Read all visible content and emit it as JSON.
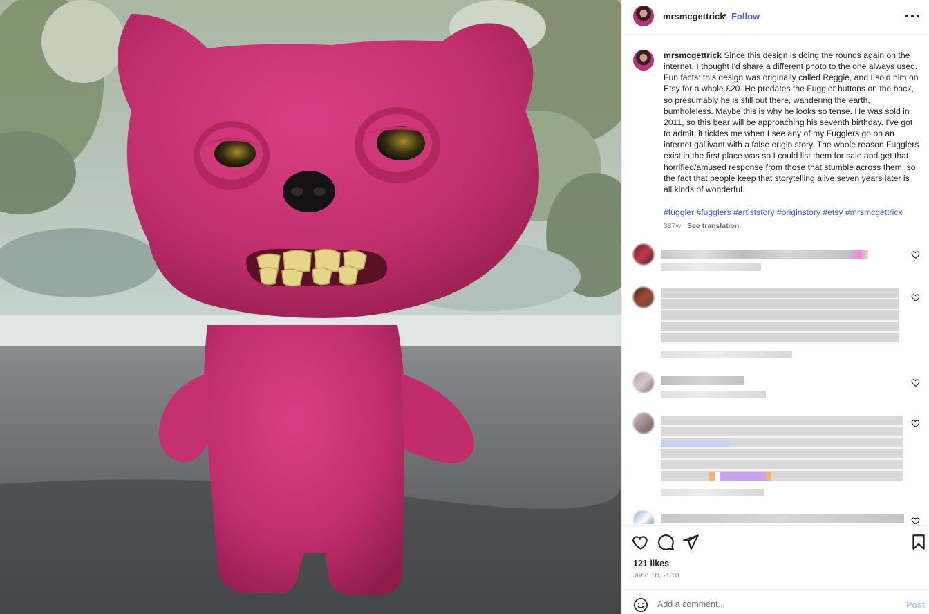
{
  "post": {
    "username": "mrsmcgettrick",
    "separator": "•",
    "follow_label": "Follow",
    "more_icon": "more-horizontal-icon",
    "photo_description_icon": "photo",
    "caption": "Since this design is doing the rounds again on the internet, I thought I'd share a different photo to the one always used. Fun facts: this design was originally called Reggie, and I sold him on Etsy for a whole £20. He predates the Fuggler buttons on the back, so presumably he is still out there, wandering the earth, bumholeless. Maybe this is why he looks so tense. He was sold in 2011, so this bear will be approaching his seventh birthday. I've got to admit, it tickles me when I see any of my Fugglers go on an internet gallivant with a false origin story. The whole reason Fugglers exist in the first place was so I could list them for sale and get that horrified/amused response from those that stumble across them, so the fact that people keep that storytelling alive seven years later is all kinds of wonderful.",
    "hashtags": [
      "#fuggler",
      "#fugglers",
      "#artiststory",
      "#originstory",
      "#etsy",
      "#mrsmcgettrick"
    ],
    "age": "387w",
    "see_translation": "See translation",
    "likes": "121 likes",
    "date": "June 18, 2018",
    "comment_placeholder": "Add a comment...",
    "post_label": "Post"
  },
  "colors": {
    "link": "#3f5cc4",
    "follow": "#4a5df9",
    "post_disabled": "#b3c6f5",
    "muted": "#8e8e8e"
  }
}
